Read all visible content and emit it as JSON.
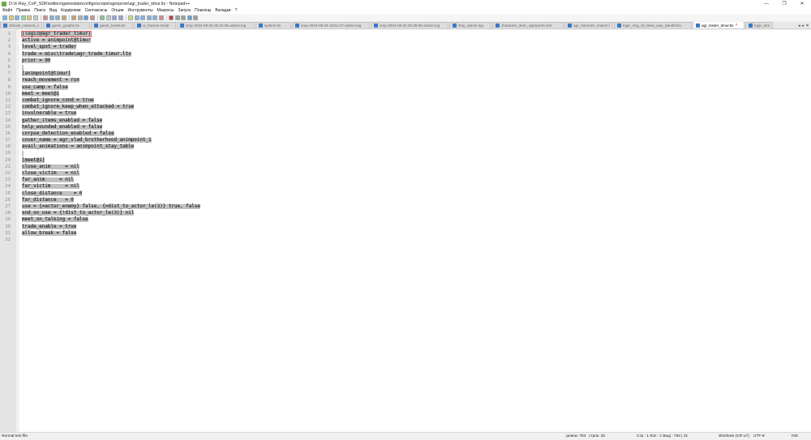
{
  "window": {
    "title": "D:\\X-Ray_CoP_SDK\\editors\\gamedata\\configs\\scripts\\agroprom\\agr_trader_timur.ltx - Notepad++",
    "controls": [
      "—",
      "❐",
      "✕"
    ]
  },
  "menu": [
    "Файл",
    "Правка",
    "Поиск",
    "Вид",
    "Кодировки",
    "Синтаксисы",
    "Опции",
    "Инструменты",
    "Макросы",
    "Запуск",
    "Плагины",
    "Вкладки",
    "?"
  ],
  "tabs": [
    {
      "label": "default_cutsene_data.ltx",
      "w": 52
    },
    {
      "label": "game_graphs.ltx",
      "w": 58
    },
    {
      "label": "game_levels.ltx",
      "w": 52
    },
    {
      "label": "ui_frames.script",
      "w": 52
    },
    {
      "label": "xray-2024-08-20 05:22:25-admin.log",
      "w": 96
    },
    {
      "label": "system.ltx",
      "w": 44
    },
    {
      "label": "xray-2024-08-22 18:51:47-admin.log",
      "w": 96
    },
    {
      "label": "xray-2024-08-22 20:35:55-admin.log",
      "w": 96
    },
    {
      "label": "stay_admin.log",
      "w": 52
    },
    {
      "label": "character_desc_agroprom.xml",
      "w": 88
    },
    {
      "label": "agr_hammer_nnetch.ltx",
      "w": 60
    },
    {
      "label": "logic_ring_sk_blow_way_banditt.ltx",
      "w": 96
    },
    {
      "label": "agr_trader_timur.ltx",
      "w": 64,
      "active": true
    },
    {
      "label": "logic_sim",
      "w": 34
    }
  ],
  "tab_scroll": [
    "◂",
    "▸",
    "✕"
  ],
  "editor": {
    "lines": [
      "[logic@agr_trader_timur]",
      "active = animpoint@timur",
      "level_spot = trader",
      "trade = misc\\trade\\agr_trade_timur.ltx",
      "prior = 90",
      "",
      "[animpoint@timur]",
      "reach_movement = run",
      "use_camp = false",
      "meet = meet@1",
      "combat_ignore_cond = true",
      "combat_ignore_keep_when_attacked = true",
      "invulnerable = true",
      "gather_items_enabled = false",
      "help_wounded_enabled = false",
      "corpse_detection_enabled = false",
      "cover_name = agr_vlad_brotherhood_animpoint_1",
      "avail_animations = animpoint_stay_table",
      "",
      "[meet@1]",
      "close_anim     = nil",
      "close_victim   = nil",
      "far_anim     = nil",
      "far_victim     = nil",
      "close_distance    = 0",
      "far_distance   = 0",
      "use = {=actor_enemy} false, {=dist_to_actor_le(3)} true, false",
      "snd_on_use = {!dist_to_actor_le(3)} nil",
      "meet_on_talking = false",
      "trade_enable = true",
      "allow_break = false",
      ""
    ]
  },
  "status": {
    "file_type": "Normal text file",
    "length": "длина: 784",
    "lines": "строк: 32",
    "line_col": "Стр : 1    Кол : 1    Выд : 784 | 31",
    "eol": "Windows (CR LF)",
    "encoding": "UTF-8",
    "mode": "INS"
  }
}
